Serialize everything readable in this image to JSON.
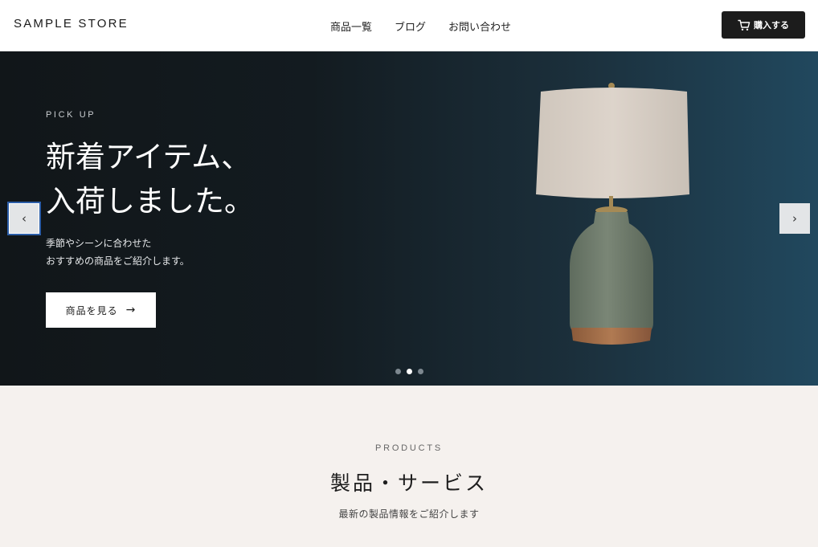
{
  "header": {
    "logo": "SAMPLE STORE",
    "nav": [
      {
        "label": "商品一覧"
      },
      {
        "label": "ブログ"
      },
      {
        "label": "お問い合わせ"
      }
    ],
    "buy_button": {
      "label": "購入する",
      "icon": "cart-icon"
    }
  },
  "hero": {
    "eyebrow": "PICK UP",
    "title_lines": [
      "新着アイテム、",
      "入荷しました。"
    ],
    "description_lines": [
      "季節やシーンに合わせた",
      "おすすめの商品をご紹介します。"
    ],
    "cta_label": "商品を見る",
    "cta_arrow": "→",
    "prev_arrow": "‹",
    "next_arrow": "›",
    "slides": {
      "count": 3,
      "active_index": 2
    },
    "image": "table-lamp",
    "colors": {
      "background_start": "#111619",
      "background_end": "#21485e"
    }
  },
  "products": {
    "eyebrow": "PRODUCTS",
    "title": "製品・サービス",
    "subtitle": "最新の製品情報をご紹介します"
  }
}
